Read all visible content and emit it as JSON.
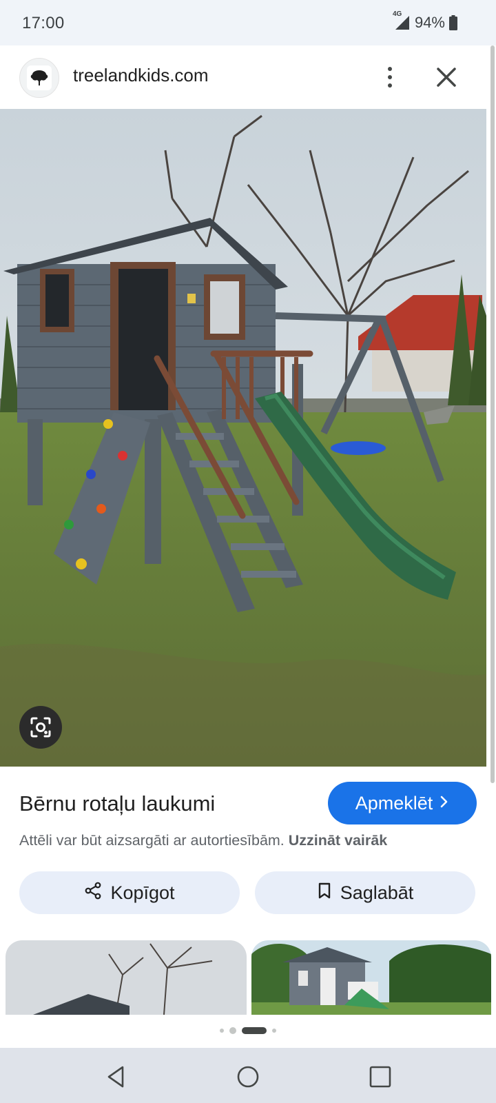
{
  "status_bar": {
    "time": "17:00",
    "network": "4G",
    "battery": "94%",
    "battery_level": 0.94,
    "icons": [
      "signal-icon",
      "battery-icon"
    ]
  },
  "header": {
    "domain": "treelandkids.com",
    "icons": [
      "site-logo-icon",
      "more-vert-icon",
      "close-icon"
    ]
  },
  "image": {
    "description_icon": "lens-icon"
  },
  "result": {
    "title": "Bērnu rotaļu laukumi",
    "visit_label": "Apmeklēt",
    "visit_icon": "chevron-right-icon",
    "copyright_text": "Attēli var būt aizsargāti ar autortiesībām.",
    "learn_more": "Uzzināt vairāk"
  },
  "actions": {
    "share_label": "Kopīgot",
    "share_icon": "share-icon",
    "save_label": "Saglabāt",
    "save_icon": "bookmark-icon"
  },
  "pager": {
    "count": 4,
    "active_index": 2
  },
  "colors": {
    "accent": "#1a73e8",
    "chip_bg": "#e8eef9",
    "status_bg": "#f0f4f9"
  },
  "nav": {
    "icons": [
      "back-icon",
      "home-icon",
      "recents-icon"
    ]
  }
}
